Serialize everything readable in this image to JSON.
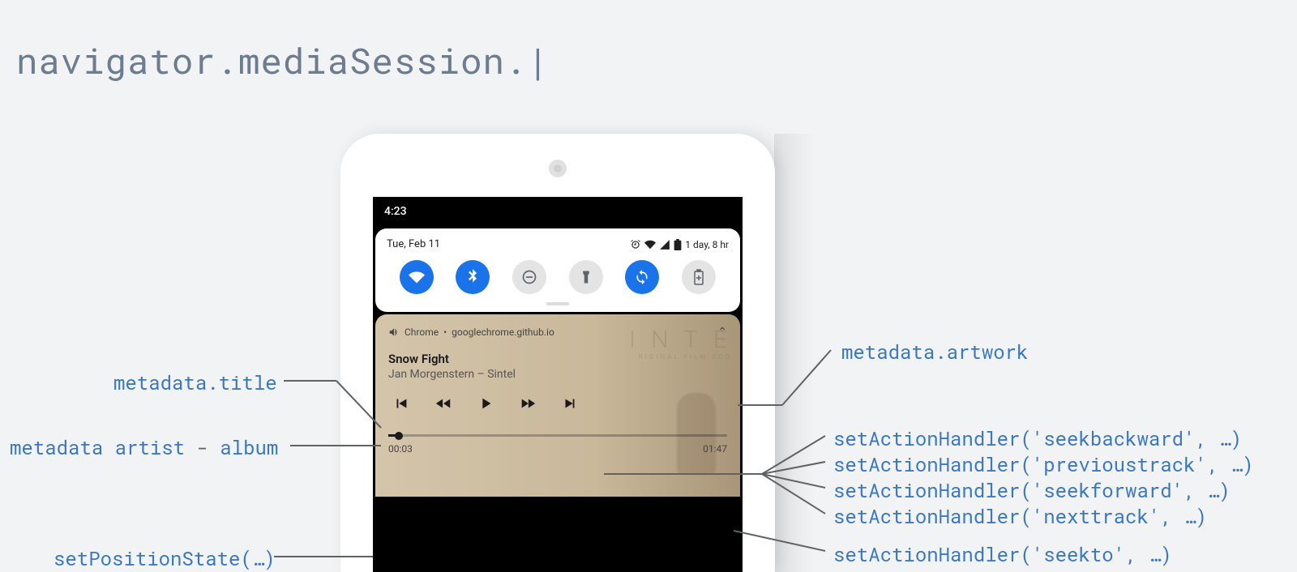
{
  "title": "navigator.mediaSession.|",
  "phone": {
    "clock": "4:23",
    "qs": {
      "date": "Tue, Feb 11",
      "battery_text": "1 day, 8 hr"
    },
    "media": {
      "app": "Chrome",
      "source": "googlechrome.github.io",
      "title": "Snow Fight",
      "artist_album": "Jan Morgenstern – Sintel",
      "position": "00:03",
      "duration": "01:47"
    }
  },
  "labels": {
    "title": "metadata.title",
    "artist_prefix": "metadata artist",
    "artist_dash": " - ",
    "artist_suffix": "album",
    "position": "setPositionState(…)",
    "artwork": "metadata.artwork",
    "seekbackward": "setActionHandler('seekbackward', …)",
    "previoustrack": "setActionHandler('previoustrack', …)",
    "seekforward": "setActionHandler('seekforward', …)",
    "nexttrack": "setActionHandler('nexttrack', …)",
    "seekto": "setActionHandler('seekto', …)"
  }
}
